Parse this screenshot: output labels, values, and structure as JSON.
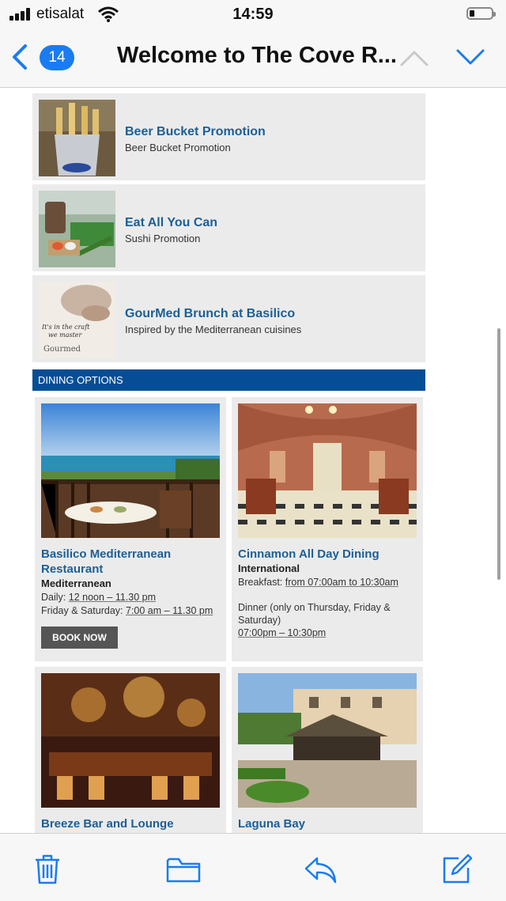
{
  "status_bar": {
    "carrier": "etisalat",
    "time": "14:59"
  },
  "nav": {
    "unread_count": "14",
    "title": "Welcome to The Cove R..."
  },
  "promotions": [
    {
      "title": "Beer Bucket Promotion",
      "subtitle": "Beer Bucket Promotion",
      "image": "beer-bucket-photo"
    },
    {
      "title": "Eat All You Can",
      "subtitle": "Sushi Promotion",
      "image": "sushi-photo"
    },
    {
      "title": "GourMed Brunch at Basilico",
      "subtitle": "Inspired by the Mediterranean cuisines",
      "image": "gourmed-photo",
      "image_caption_1": "It's in the craft",
      "image_caption_2": "we master",
      "image_logo": "Gourmed"
    }
  ],
  "dining": {
    "header": "DINING OPTIONS",
    "cards": [
      {
        "title": "Basilico Mediterranean Restaurant",
        "category": "Mediterranean",
        "line1_label": "Daily:",
        "line1_value": "12 noon – 11.30 pm",
        "line2_label": "Friday & Saturday:",
        "line2_value": "7:00 am – 11.30 pm",
        "button": "BOOK NOW"
      },
      {
        "title": "Cinnamon All Day Dining",
        "category": "International",
        "line1_label": "Breakfast:",
        "line1_value": "from 07:00am to 10:30am",
        "line2_a": "Dinner (only on Thursday, Friday &",
        "line2_b": "Saturday)",
        "line3_value": "07:00pm – 10:30pm"
      },
      {
        "title": "Breeze Bar and Lounge"
      },
      {
        "title": "Laguna Bay"
      }
    ]
  },
  "colors": {
    "accent": "#1a7cf0",
    "link": "#1c5f95",
    "header_bar": "#054e95",
    "button": "#555555"
  },
  "toolbar": {
    "icons": [
      "trash-icon",
      "folder-icon",
      "reply-icon",
      "compose-icon"
    ]
  }
}
